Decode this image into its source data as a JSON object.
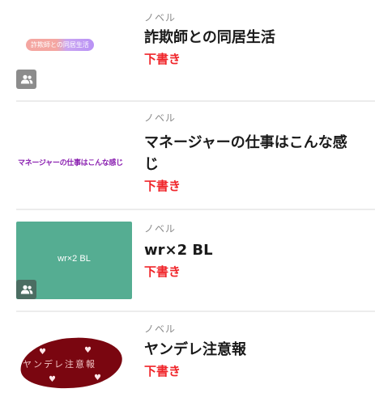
{
  "works": [
    {
      "type_label": "ノベル",
      "title": "詐欺師との同居生活",
      "status": "下書き",
      "thumbnail_text": "詐欺師との同居生活",
      "shared": true
    },
    {
      "type_label": "ノベル",
      "title": "マネージャーの仕事はこんな感じ",
      "status": "下書き",
      "thumbnail_text": "マネージャーの仕事はこんな感じ",
      "shared": false
    },
    {
      "type_label": "ノベル",
      "title": "wr×2 BL",
      "status": "下書き",
      "thumbnail_text": "wr×2 BL",
      "thumbnail_bg": "#55ad92",
      "shared": true
    },
    {
      "type_label": "ノベル",
      "title": "ヤンデレ注意報",
      "status": "下書き",
      "thumbnail_text": "ヤンデレ注意報",
      "thumbnail_bg": "#7a0610",
      "shared": false
    }
  ],
  "colors": {
    "status_draft": "#f0262b",
    "separator": "#ececec",
    "type_label": "#8a8a8a"
  },
  "icons": {
    "shared_badge": "group-icon"
  }
}
